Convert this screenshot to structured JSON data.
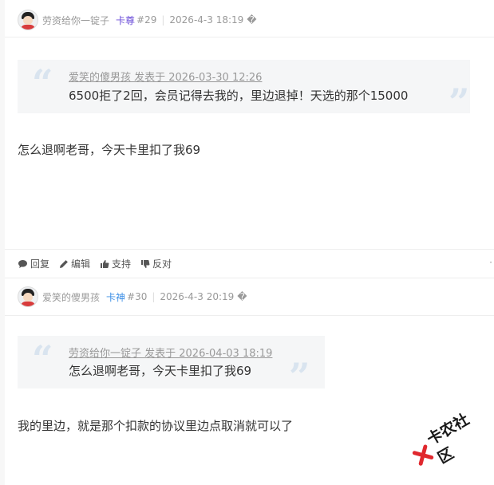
{
  "colors": {
    "badge_zun": "#6d4fd9",
    "badge_shen": "#3a8ee6",
    "quote_bg": "#f5f6f7",
    "quote_mark": "#d9e4ef",
    "action_icon": "#555555"
  },
  "posts": [
    {
      "username": "劳资给你一锭子",
      "badge": "卡尊",
      "floor": "#29",
      "separator": "|",
      "time": "2026-4-3 18:19",
      "time_suffix": "�",
      "quote": {
        "author_line": "爱笑的傻男孩 发表于 2026-03-30 12:26",
        "text": "6500拒了2回，会员记得去我的，里边退掉！天选的那个15000"
      },
      "content": "怎么退啊老哥，今天卡里扣了我69",
      "actions": [
        {
          "icon": "comment-icon",
          "label": "回复"
        },
        {
          "icon": "pencil-icon",
          "label": "编辑"
        },
        {
          "icon": "thumbs-up-icon",
          "label": "支持"
        },
        {
          "icon": "thumbs-down-icon",
          "label": "反对"
        }
      ],
      "more": "·"
    },
    {
      "username": "爱笑的傻男孩",
      "badge": "卡神",
      "floor": "#30",
      "separator": "|",
      "time": "2026-4-3 20:19",
      "time_suffix": "�",
      "quote": {
        "author_line": "劳资给你一锭子 发表于 2026-04-03 18:19",
        "text": "怎么退啊老哥，今天卡里扣了我69"
      },
      "content": "我的里边，就是那个扣款的协议里边点取消就可以了"
    }
  ],
  "watermark": {
    "text": "卡农社区",
    "logo_icon": "kanong-logo-icon"
  }
}
